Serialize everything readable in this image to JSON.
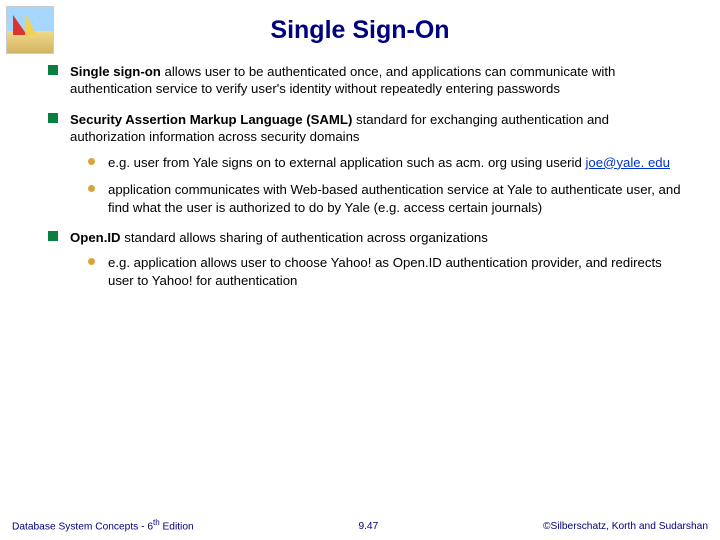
{
  "title": "Single Sign-On",
  "bullets": {
    "b1_bold": "Single sign-on",
    "b1_rest": " allows user to be authenticated once, and applications can communicate with authentication service to verify user's identity without repeatedly entering passwords",
    "b2_bold": "Security Assertion Markup Language (SAML)",
    "b2_rest": " standard for exchanging authentication and authorization information across security domains",
    "b2_sub1_pre": "e.g. user from Yale signs on to external application such as acm. org using userid ",
    "b2_sub1_link": "joe@yale. edu",
    "b2_sub2": "application communicates with Web-based authentication service at Yale to authenticate user, and find what the user is authorized to do by Yale (e.g. access certain journals)",
    "b3_bold": "Open.ID",
    "b3_rest": " standard allows sharing of authentication across organizations",
    "b3_sub1": "e.g. application allows user to choose Yahoo! as Open.ID authentication provider, and redirects user to Yahoo! for authentication"
  },
  "footer": {
    "left_pre": "Database System Concepts - 6",
    "left_sup": "th",
    "left_post": " Edition",
    "center": "9.47",
    "right": "©Silberschatz, Korth and Sudarshan"
  }
}
